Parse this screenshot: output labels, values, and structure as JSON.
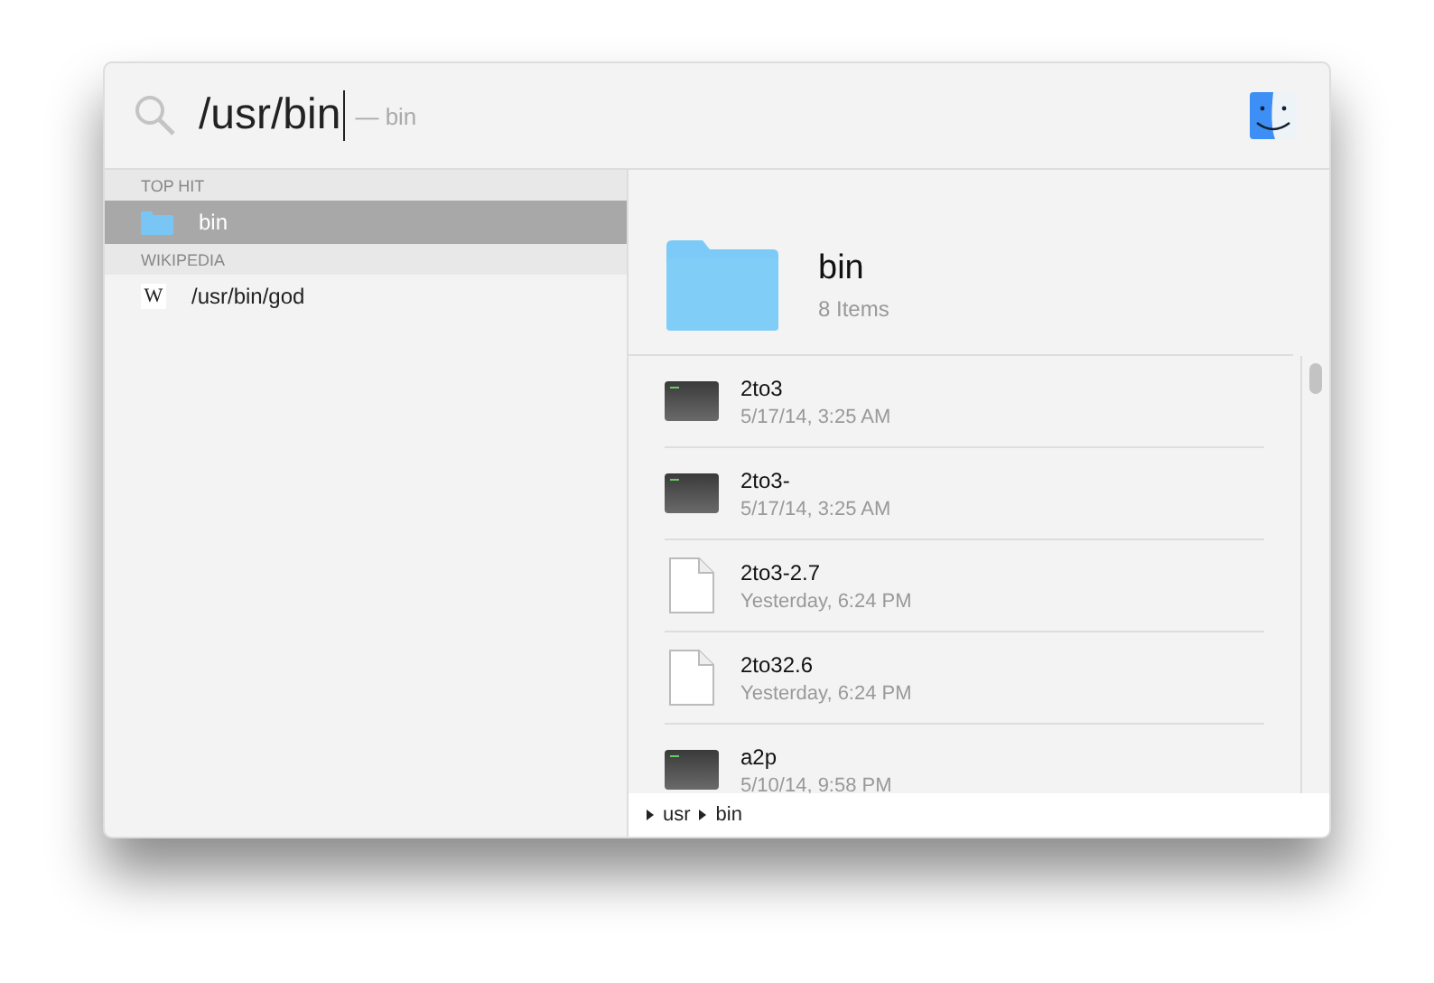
{
  "search": {
    "query": "/usr/bin",
    "hint": "— bin"
  },
  "results": [
    {
      "heading": "TOP HIT",
      "items": [
        {
          "label": "bin",
          "kind": "folder",
          "selected": true
        }
      ]
    },
    {
      "heading": "WIKIPEDIA",
      "items": [
        {
          "label": "/usr/bin/god",
          "kind": "wikipedia",
          "icon_text": "W",
          "selected": false
        }
      ]
    }
  ],
  "preview": {
    "title": "bin",
    "subtitle": "8 Items",
    "files": [
      {
        "name": "2to3",
        "date": "5/17/14, 3:25 AM",
        "kind": "executable"
      },
      {
        "name": "2to3-",
        "date": "5/17/14, 3:25 AM",
        "kind": "executable"
      },
      {
        "name": "2to3-2.7",
        "date": "Yesterday, 6:24 PM",
        "kind": "document"
      },
      {
        "name": "2to32.6",
        "date": "Yesterday, 6:24 PM",
        "kind": "document"
      },
      {
        "name": "a2p",
        "date": "5/10/14, 9:58 PM",
        "kind": "executable"
      }
    ],
    "path": [
      "usr",
      "bin"
    ]
  }
}
